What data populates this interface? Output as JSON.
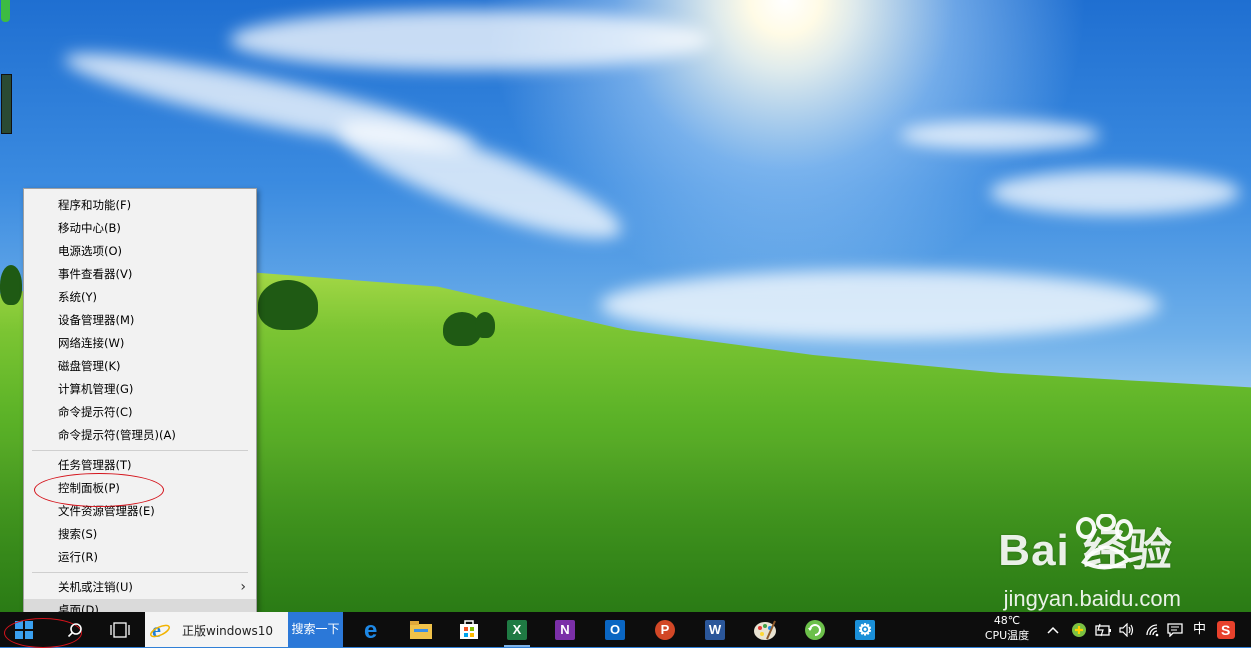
{
  "context_menu": {
    "group1": [
      "程序和功能(F)",
      "移动中心(B)",
      "电源选项(O)",
      "事件查看器(V)",
      "系统(Y)",
      "设备管理器(M)",
      "网络连接(W)",
      "磁盘管理(K)",
      "计算机管理(G)",
      "命令提示符(C)",
      "命令提示符(管理员)(A)"
    ],
    "group2": [
      "任务管理器(T)",
      "控制面板(P)",
      "文件资源管理器(E)",
      "搜索(S)",
      "运行(R)"
    ],
    "shutdown": "关机或注销(U)",
    "desktop": "桌面(D)"
  },
  "taskbar": {
    "ie_window_title": "正版windows10",
    "search_button": "搜索一下",
    "cpu_temp_value": "48℃",
    "cpu_temp_label": "CPU温度",
    "ime_label": "中",
    "apps": [
      "edge-icon",
      "file-explorer-icon",
      "store-icon",
      "excel-icon",
      "onenote-icon",
      "outlook-icon",
      "powerpoint-icon",
      "word-icon",
      "paint-icon",
      "refresh-app-icon",
      "settings-icon"
    ]
  },
  "watermark": {
    "logo": "Bai 经验",
    "url": "jingyan.baidu.com"
  },
  "colors": {
    "highlight_ellipse": "#d4131b",
    "taskbar": "#0d0d0d",
    "search_button": "#2b78d8"
  }
}
